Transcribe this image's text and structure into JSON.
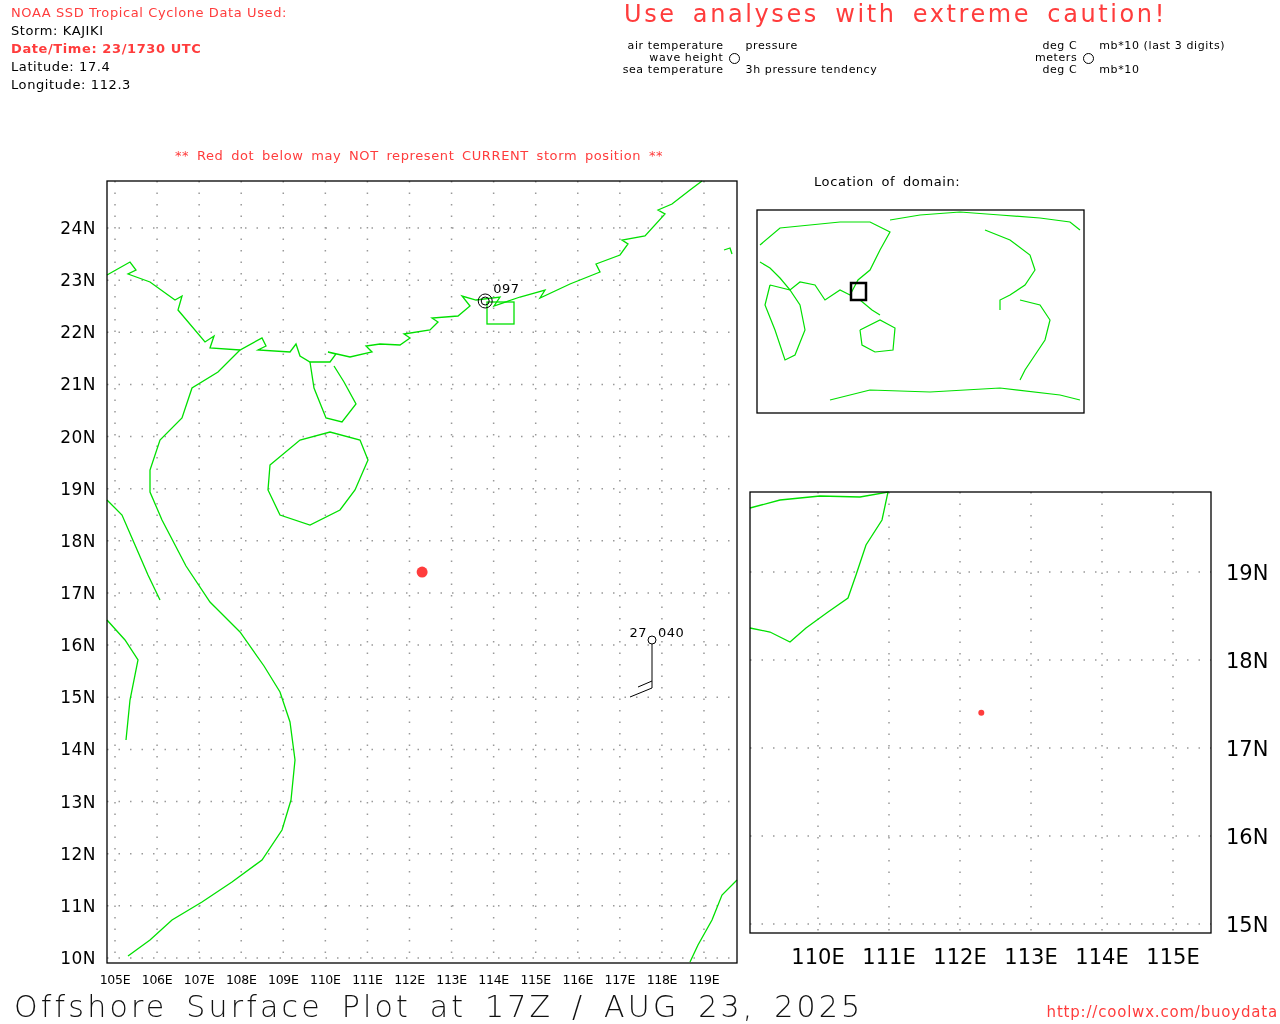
{
  "header": {
    "source": "NOAA SSD Tropical Cyclone Data Used:",
    "storm": "Storm: KAJIKI",
    "datetime": "Date/Time: 23/1730 UTC",
    "latitude": "Latitude: 17.4",
    "longitude": "Longitude: 112.3"
  },
  "caution": "Use analyses with extreme caution!",
  "station_legend": {
    "left_top": "air temperature",
    "left_middle": "wave height",
    "left_bottom": "sea temperature",
    "right_top": "pressure",
    "right_bottom": "3h pressure tendency"
  },
  "units_legend": {
    "left_top": "deg C",
    "left_middle": "meters",
    "left_bottom": "deg C",
    "right_top": "mb*10 (last 3 digits)",
    "right_bottom": "mb*10"
  },
  "warning": "** Red dot below may NOT represent CURRENT storm position **",
  "main_map": {
    "lat_labels": [
      "24N",
      "23N",
      "22N",
      "21N",
      "20N",
      "19N",
      "18N",
      "17N",
      "16N",
      "15N",
      "14N",
      "13N",
      "12N",
      "11N",
      "10N"
    ],
    "lon_labels": [
      "105E",
      "106E",
      "107E",
      "108E",
      "109E",
      "110E",
      "111E",
      "112E",
      "113E",
      "114E",
      "115E",
      "116E",
      "117E",
      "118E",
      "119E"
    ],
    "stations": [
      {
        "kind": "ring",
        "pressure": "097"
      },
      {
        "kind": "barb",
        "air_temperature": "27",
        "pressure": "040"
      }
    ]
  },
  "domain_map": {
    "title": "Location of domain:"
  },
  "zoom_map": {
    "lat_labels": [
      "19N",
      "18N",
      "17N",
      "16N",
      "15N"
    ],
    "lon_labels": [
      "110E",
      "111E",
      "112E",
      "113E",
      "114E",
      "115E"
    ]
  },
  "footer": {
    "title": "Offshore Surface Plot at 17Z / AUG 23, 2025",
    "url": "http://coolwx.com/buoydata"
  }
}
